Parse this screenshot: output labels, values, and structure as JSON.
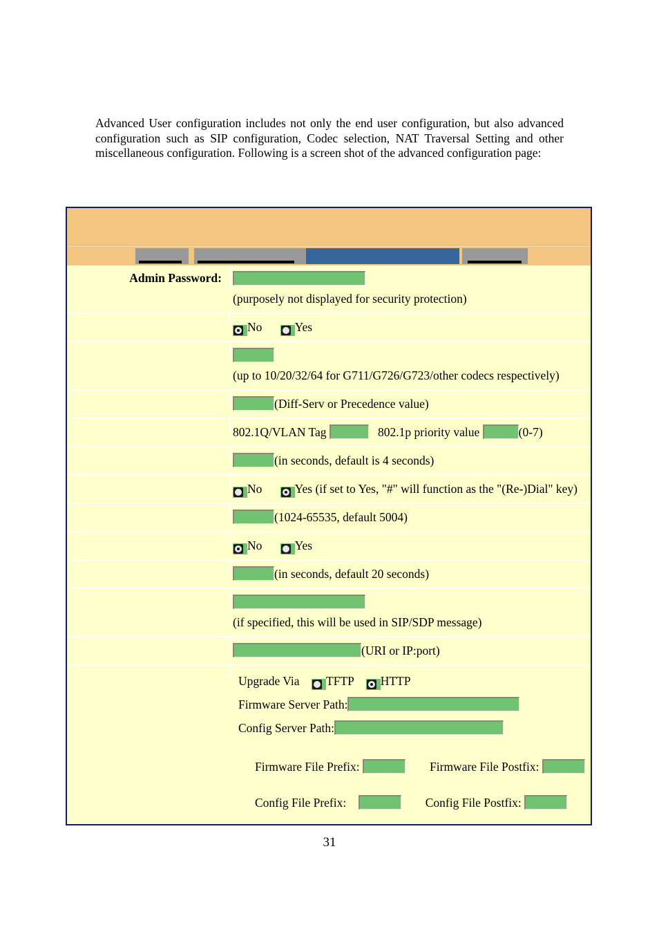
{
  "document": {
    "intro_paragraph": "Advanced User configuration includes not only the end user configuration, but also advanced configuration such as SIP configuration, Codec selection, NAT Traversal Setting and other miscellaneous configuration.  Following is a screen shot of the advanced configuration page:",
    "page_number": "31"
  },
  "colors": {
    "banner": "#f2c680",
    "form_background": "#ffffcc",
    "input_green": "#71c371",
    "tab_inactive": "#999999",
    "tab_active": "#36659d",
    "frame_border": "#121d5e"
  },
  "screenshot": {
    "tabs": [
      {
        "name": "tab-1",
        "label": "",
        "active": false
      },
      {
        "name": "tab-2",
        "label": "",
        "active": false
      },
      {
        "name": "tab-3",
        "label": "",
        "active": true
      },
      {
        "name": "tab-4",
        "label": "",
        "active": false
      }
    ],
    "rows": [
      {
        "label": "Admin Password:",
        "hint_before": "",
        "hint_after": "(purposely not displayed for security protection)",
        "value": ""
      },
      {
        "label": "",
        "options": [
          {
            "label": "No",
            "selected": true
          },
          {
            "label": "Yes",
            "selected": false
          }
        ],
        "hint_after": ""
      },
      {
        "label": "",
        "value": "",
        "hint_after": "(up to 10/20/32/64 for G711/G726/G723/other codecs respectively)"
      },
      {
        "label": "",
        "value": "",
        "hint_after": "(Diff-Serv or Precedence value)"
      },
      {
        "label": "",
        "field_label_1": "802.1Q/VLAN Tag",
        "value_1": "",
        "field_label_2": "802.1p priority value",
        "value_2": "",
        "hint_after": "(0-7)"
      },
      {
        "label": "",
        "value": "",
        "hint_after": "(in seconds, default is 4 seconds)"
      },
      {
        "label": "",
        "options": [
          {
            "label": "No",
            "selected": false
          },
          {
            "label": "Yes",
            "selected": true
          }
        ],
        "hint_after": "(if set to Yes, \"#\" will function as the \"(Re-)Dial\" key)"
      },
      {
        "label": "",
        "value": "",
        "hint_after": "(1024-65535, default 5004)"
      },
      {
        "label": "",
        "options": [
          {
            "label": "No",
            "selected": true
          },
          {
            "label": "Yes",
            "selected": false
          }
        ],
        "hint_after": ""
      },
      {
        "label": "",
        "value": "",
        "hint_after": "(in seconds, default 20 seconds)"
      },
      {
        "label": "",
        "value": "",
        "hint_after": "(if specified, this will be used in SIP/SDP message)"
      },
      {
        "label": "",
        "value": "",
        "hint_after": "(URI or IP:port)"
      }
    ],
    "upgrade_block": {
      "upgrade_via_label": "Upgrade Via",
      "upgrade_options": [
        {
          "label": "TFTP",
          "selected": false
        },
        {
          "label": "HTTP",
          "selected": true
        }
      ],
      "firmware_server_path_label": "Firmware Server Path:",
      "firmware_server_path_value": "",
      "config_server_path_label": "Config Server Path:",
      "config_server_path_value": "",
      "firmware_file_prefix_label": "Firmware File Prefix:",
      "firmware_file_prefix_value": "",
      "firmware_file_postfix_label": "Firmware File Postfix:",
      "firmware_file_postfix_value": "",
      "config_file_prefix_label": "Config File Prefix:",
      "config_file_prefix_value": "",
      "config_file_postfix_label": "Config File Postfix:",
      "config_file_postfix_value": ""
    }
  }
}
